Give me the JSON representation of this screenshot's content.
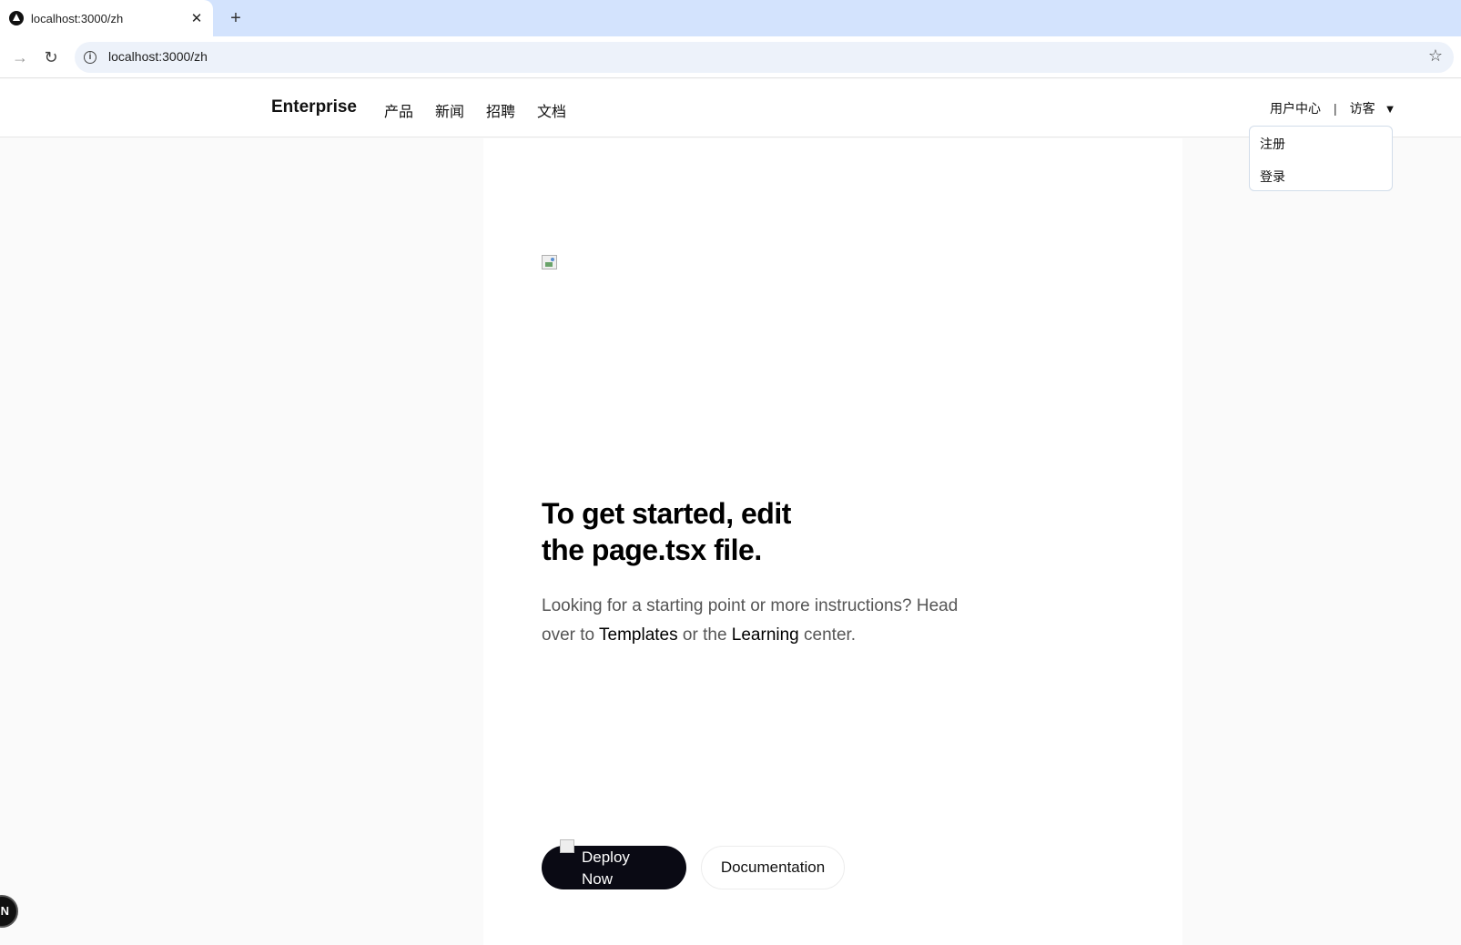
{
  "browser": {
    "tab_title": "localhost:3000/zh",
    "close_glyph": "✕",
    "newtab_glyph": "+",
    "forward_glyph": "→",
    "reload_glyph": "↻",
    "url": "localhost:3000/zh",
    "info_glyph": "i",
    "star_glyph": "☆"
  },
  "header": {
    "brand": "Enterprise",
    "nav": [
      "产品",
      "新闻",
      "招聘",
      "文档"
    ],
    "user_center": "用户中心",
    "separator": "|",
    "visitor": "访客",
    "caret": "▼"
  },
  "dropdown": {
    "items": [
      "注册",
      "登录"
    ]
  },
  "main": {
    "headline": "To get started, edit the page.tsx file.",
    "desc_part1": "Looking for a starting point or more instructions? Head over to ",
    "link_templates": "Templates",
    "desc_part2": " or the ",
    "link_learning": "Learning",
    "desc_part3": " center.",
    "deploy_label": "Deploy Now",
    "docs_label": "Documentation"
  },
  "devtools": {
    "badge": "N"
  },
  "colors": {
    "tabstrip": "#d3e3fd",
    "omnibox": "#edf2fa",
    "page_bg": "#fafafa",
    "deploy_bg": "#0a0a14"
  }
}
